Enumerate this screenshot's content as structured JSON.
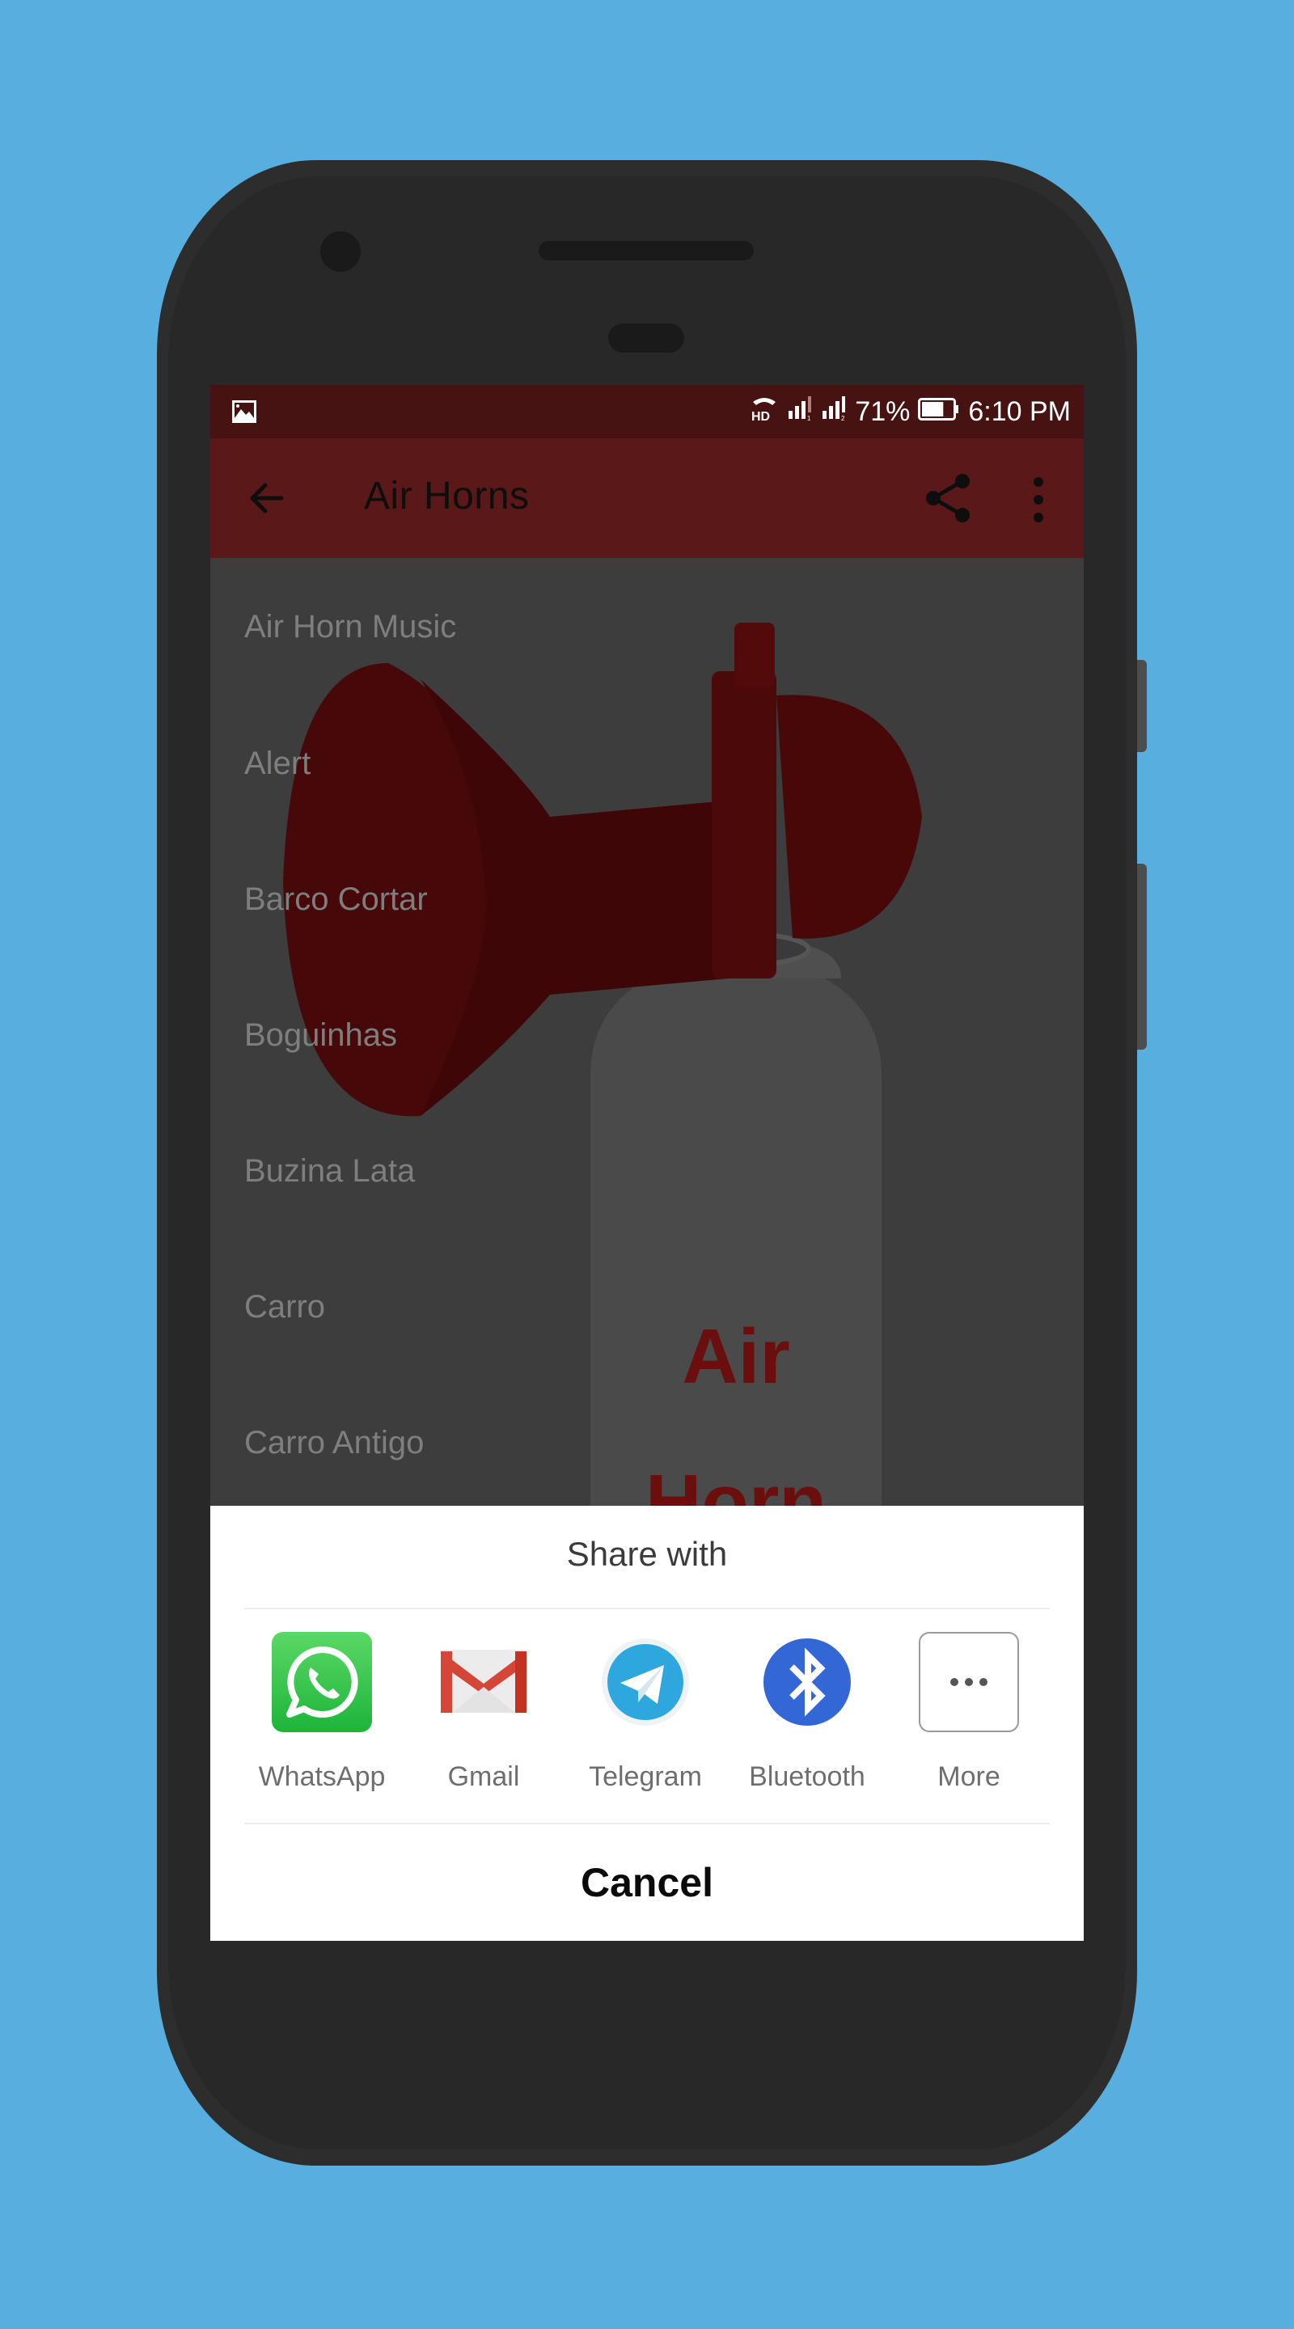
{
  "status_bar": {
    "notification_icon": "image-icon",
    "hd_voice_icon": "hd-call-icon",
    "sim1_signal_icon": "signal-sim1-icon",
    "sim2_signal_icon": "signal-sim2-icon",
    "battery_percent": "71%",
    "battery_level": 0.71,
    "time": "6:10 PM"
  },
  "app_bar": {
    "title": "Air Horns",
    "back_icon": "arrow-back-icon",
    "share_icon": "share-icon",
    "menu_icon": "more-vert-icon",
    "background_color": "#5a1818"
  },
  "sound_list": [
    {
      "label": "Air Horn Music"
    },
    {
      "label": "Alert"
    },
    {
      "label": "Barco Cortar"
    },
    {
      "label": "Boguinhas"
    },
    {
      "label": "Buzina Lata"
    },
    {
      "label": "Carro"
    },
    {
      "label": "Carro Antigo"
    }
  ],
  "background_art": {
    "can_text_line1": "Air",
    "can_text_line2": "Horn"
  },
  "share_sheet": {
    "title": "Share with",
    "targets": [
      {
        "label": "WhatsApp",
        "icon": "whatsapp-icon",
        "color": "#25c13f"
      },
      {
        "label": "Gmail",
        "icon": "gmail-icon",
        "color": "#d44638"
      },
      {
        "label": "Telegram",
        "icon": "telegram-icon",
        "color": "#2ea6de"
      },
      {
        "label": "Bluetooth",
        "icon": "bluetooth-icon",
        "color": "#3467d6"
      },
      {
        "label": "More",
        "icon": "more-horiz-icon",
        "color": "#666666"
      }
    ],
    "cancel_label": "Cancel"
  }
}
